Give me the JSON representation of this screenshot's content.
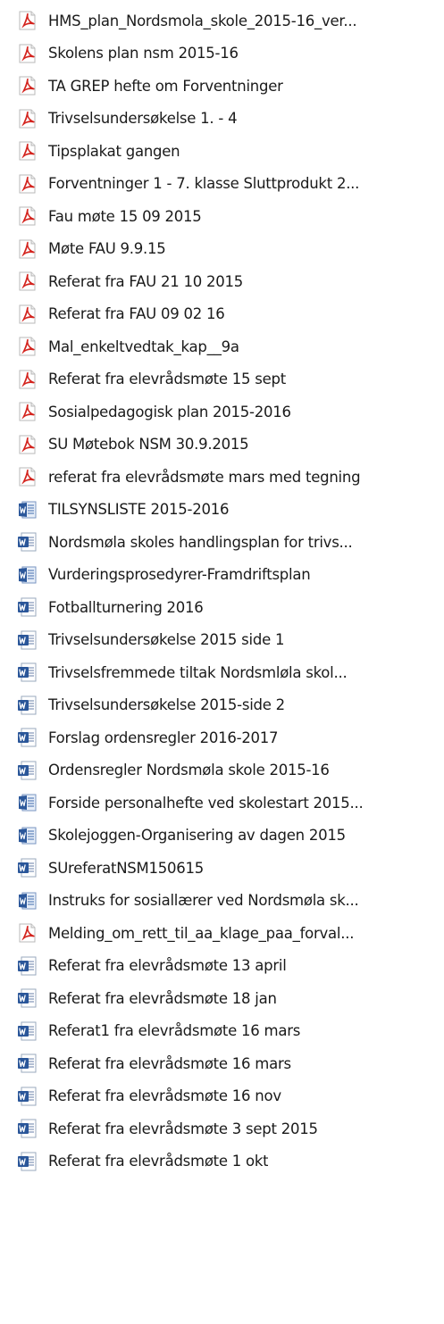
{
  "colors": {
    "pdf": "#d3221c",
    "word": "#2a5699",
    "text": "#1a1a1a"
  },
  "files": [
    {
      "label": "HMS_plan_Nordsmola_skole_2015-16_ver...",
      "icon": "pdf-icon"
    },
    {
      "label": "Skolens plan  nsm 2015-16",
      "icon": "pdf-icon"
    },
    {
      "label": "TA GREP hefte om Forventninger",
      "icon": "pdf-icon"
    },
    {
      "label": "Trivselsundersøkelse 1. - 4",
      "icon": "pdf-icon"
    },
    {
      "label": "Tipsplakat gangen",
      "icon": "pdf-icon"
    },
    {
      "label": "Forventninger 1 - 7. klasse Sluttprodukt 2...",
      "icon": "pdf-icon"
    },
    {
      "label": "Fau møte 15 09 2015",
      "icon": "pdf-icon"
    },
    {
      "label": "Møte FAU 9.9.15",
      "icon": "pdf-icon"
    },
    {
      "label": "Referat fra FAU 21 10 2015",
      "icon": "pdf-icon"
    },
    {
      "label": "Referat fra FAU 09 02 16",
      "icon": "pdf-icon"
    },
    {
      "label": "Mal_enkeltvedtak_kap__9a",
      "icon": "pdf-icon"
    },
    {
      "label": "Referat fra elevrådsmøte 15 sept",
      "icon": "pdf-icon"
    },
    {
      "label": "Sosialpedagogisk plan 2015-2016",
      "icon": "pdf-icon"
    },
    {
      "label": "SU Møtebok NSM 30.9.2015",
      "icon": "pdf-icon"
    },
    {
      "label": "referat fra elevrådsmøte mars med tegning",
      "icon": "pdf-icon"
    },
    {
      "label": "TILSYNSLISTE  2015-2016",
      "icon": "word-docx-icon"
    },
    {
      "label": "Nordsmøla skoles handlingsplan for trivs...",
      "icon": "word-doc-icon"
    },
    {
      "label": "Vurderingsprosedyrer-Framdriftsplan",
      "icon": "word-docx-icon"
    },
    {
      "label": "Fotballturnering 2016",
      "icon": "word-doc-icon"
    },
    {
      "label": "Trivselsundersøkelse 2015 side 1",
      "icon": "word-doc-icon"
    },
    {
      "label": "Trivselsfremmede tiltak Nordsmløla skol...",
      "icon": "word-doc-icon"
    },
    {
      "label": "Trivselsundersøkelse 2015-side 2",
      "icon": "word-doc-icon"
    },
    {
      "label": "Forslag ordensregler 2016-2017",
      "icon": "word-doc-icon"
    },
    {
      "label": "Ordensregler Nordsmøla skole 2015-16",
      "icon": "word-doc-icon"
    },
    {
      "label": "Forside personalhefte ved skolestart 2015...",
      "icon": "word-docx-icon"
    },
    {
      "label": "Skolejoggen-Organisering av dagen 2015",
      "icon": "word-docx-icon"
    },
    {
      "label": "SUreferatNSM150615",
      "icon": "word-doc-icon"
    },
    {
      "label": "Instruks for sosiallærer ved Nordsmøla sk...",
      "icon": "word-docx-icon"
    },
    {
      "label": "Melding_om_rett_til_aa_klage_paa_forval...",
      "icon": "pdf-icon"
    },
    {
      "label": "Referat fra elevrådsmøte 13 april",
      "icon": "word-doc-icon"
    },
    {
      "label": "Referat fra elevrådsmøte 18 jan",
      "icon": "word-doc-icon"
    },
    {
      "label": "Referat1 fra elevrådsmøte 16 mars",
      "icon": "word-doc-icon"
    },
    {
      "label": "Referat fra elevrådsmøte 16 mars",
      "icon": "word-doc-icon"
    },
    {
      "label": "Referat fra elevrådsmøte 16 nov",
      "icon": "word-doc-icon"
    },
    {
      "label": "Referat fra elevrådsmøte 3 sept 2015",
      "icon": "word-doc-icon"
    },
    {
      "label": "Referat fra elevrådsmøte 1 okt",
      "icon": "word-doc-icon"
    }
  ]
}
